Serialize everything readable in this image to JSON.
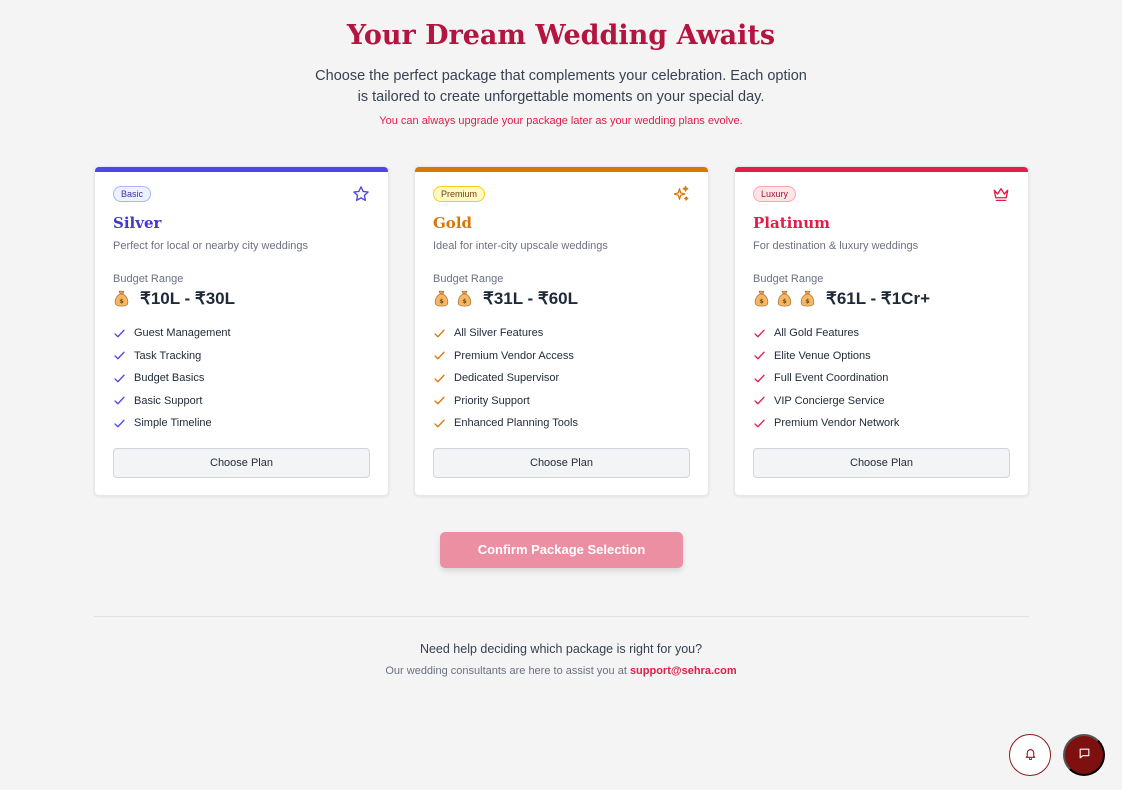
{
  "header": {
    "title": "Your Dream Wedding Awaits",
    "subtitle": "Choose the perfect package that complements your celebration. Each option is tailored to create unforgettable moments on your special day.",
    "note": "You can always upgrade your package later as your wedding plans evolve."
  },
  "cards": [
    {
      "badge": "Basic",
      "name": "Silver",
      "description": "Perfect for local or nearby city weddings",
      "budget_label": "Budget Range",
      "bag_count": 1,
      "range": "₹10L - ₹30L",
      "features": [
        "Guest Management",
        "Task Tracking",
        "Budget Basics",
        "Basic Support",
        "Simple Timeline"
      ],
      "button": "Choose Plan",
      "accent": "#4f46e5",
      "icon": "star-icon"
    },
    {
      "badge": "Premium",
      "name": "Gold",
      "description": "Ideal for inter-city upscale weddings",
      "budget_label": "Budget Range",
      "bag_count": 2,
      "range": "₹31L - ₹60L",
      "features": [
        "All Silver Features",
        "Premium Vendor Access",
        "Dedicated Supervisor",
        "Priority Support",
        "Enhanced Planning Tools"
      ],
      "button": "Choose Plan",
      "accent": "#d97706",
      "icon": "sparkles-icon"
    },
    {
      "badge": "Luxury",
      "name": "Platinum",
      "description": "For destination & luxury weddings",
      "budget_label": "Budget Range",
      "bag_count": 3,
      "range": "₹61L - ₹1Cr+",
      "features": [
        "All Gold Features",
        "Elite Venue Options",
        "Full Event Coordination",
        "VIP Concierge Service",
        "Premium Vendor Network"
      ],
      "button": "Choose Plan",
      "accent": "#e11d48",
      "icon": "crown-icon"
    }
  ],
  "confirm_button": "Confirm Package Selection",
  "help": {
    "question": "Need help deciding which package is right for you?",
    "answer_prefix": "Our wedding consultants are here to assist you at ",
    "email": "support@sehra.com"
  },
  "fabs": {
    "bell_icon": "bell-icon",
    "chat_icon": "chat-icon"
  },
  "colors": {
    "title": "#b3153f",
    "confirm_bg": "#ec8fa2",
    "chat_fab": "#7f1010"
  }
}
